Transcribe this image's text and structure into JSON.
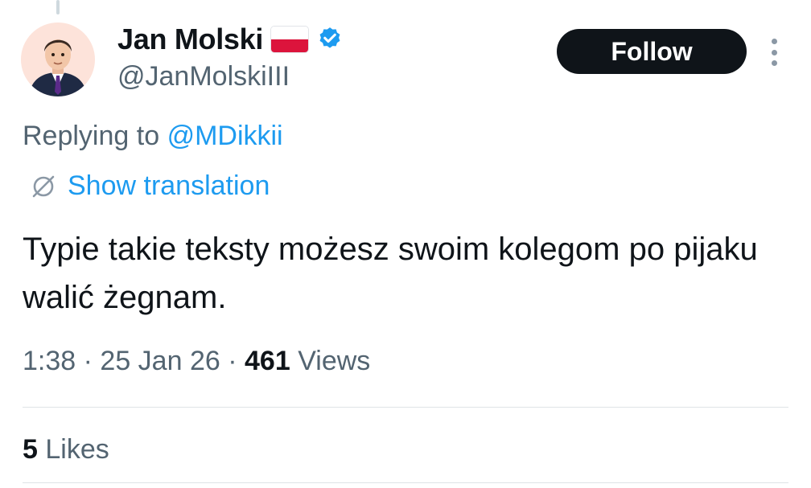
{
  "author": {
    "display_name": "Jan Molski",
    "handle": "@JanMolskiIII",
    "flag_icon": "poland-flag-icon",
    "verified_icon": "verified-badge-icon",
    "verified_color": "#1d9bf0"
  },
  "actions": {
    "follow_label": "Follow",
    "more_icon": "more-vertical-icon"
  },
  "reply": {
    "prefix": "Replying to",
    "mention": "@MDikkii"
  },
  "translation": {
    "icon": "translate-icon",
    "label": "Show translation"
  },
  "tweet": {
    "text": "Typie takie teksty możesz swoim kolegom po pijaku walić żegnam."
  },
  "meta": {
    "time": "1:38",
    "separator": "·",
    "date": "25 Jan 26",
    "views_count": "461",
    "views_label": "Views"
  },
  "engagement": {
    "likes_count": "5",
    "likes_label": "Likes"
  },
  "colors": {
    "text_primary": "#0f1419",
    "text_secondary": "#536471",
    "link": "#1d9bf0",
    "follow_bg": "#0f1419",
    "flag_red": "#dc143c"
  }
}
